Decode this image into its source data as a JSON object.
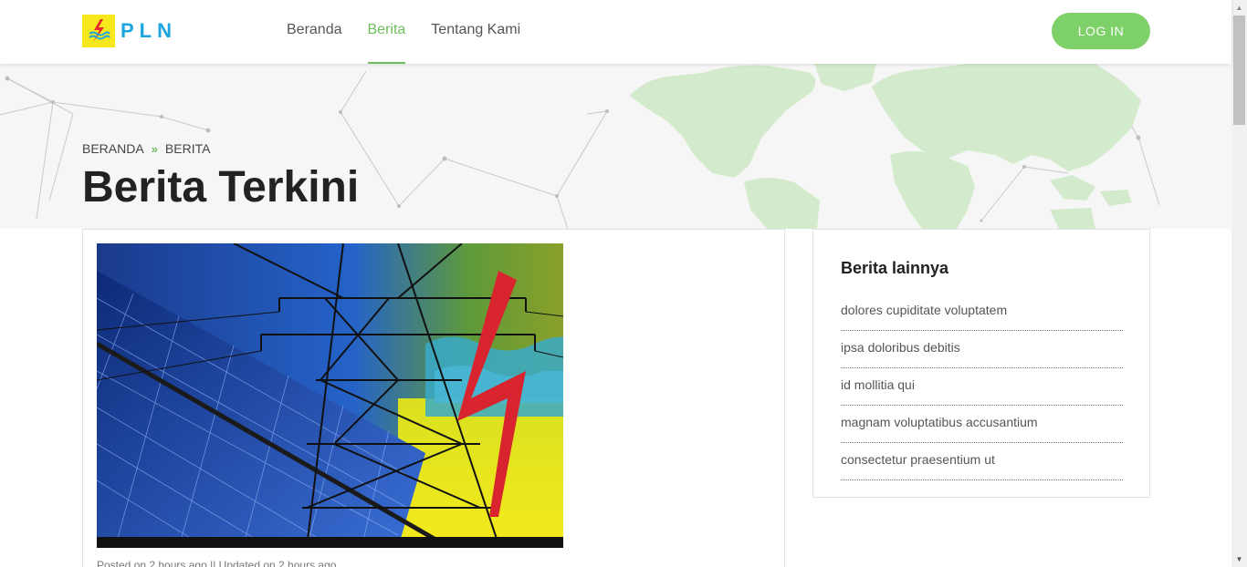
{
  "header": {
    "logo_text": "PLN",
    "nav": [
      {
        "label": "Beranda"
      },
      {
        "label": "Berita"
      },
      {
        "label": "Tentang Kami"
      }
    ],
    "login_label": "LOG IN"
  },
  "hero": {
    "breadcrumb": [
      "BERANDA",
      "BERITA"
    ],
    "title": "Berita Terkini"
  },
  "article": {
    "meta": "Posted on 2 hours ago || Updated on 2 hours ago"
  },
  "sidebar": {
    "title": "Berita lainnya",
    "items": [
      {
        "label": "dolores cupiditate voluptatem"
      },
      {
        "label": "ipsa doloribus debitis"
      },
      {
        "label": "id mollitia qui"
      },
      {
        "label": "magnam voluptatibus accusantium"
      },
      {
        "label": "consectetur praesentium ut"
      }
    ]
  },
  "colors": {
    "accent": "#6cbf5c",
    "button": "#7ed068",
    "logo_blue": "#1aa5df",
    "logo_yellow": "#f7e81e"
  },
  "icons": [
    "pln-logo-icon",
    "breadcrumb-separator-icon",
    "scroll-up-icon",
    "scroll-down-icon"
  ]
}
